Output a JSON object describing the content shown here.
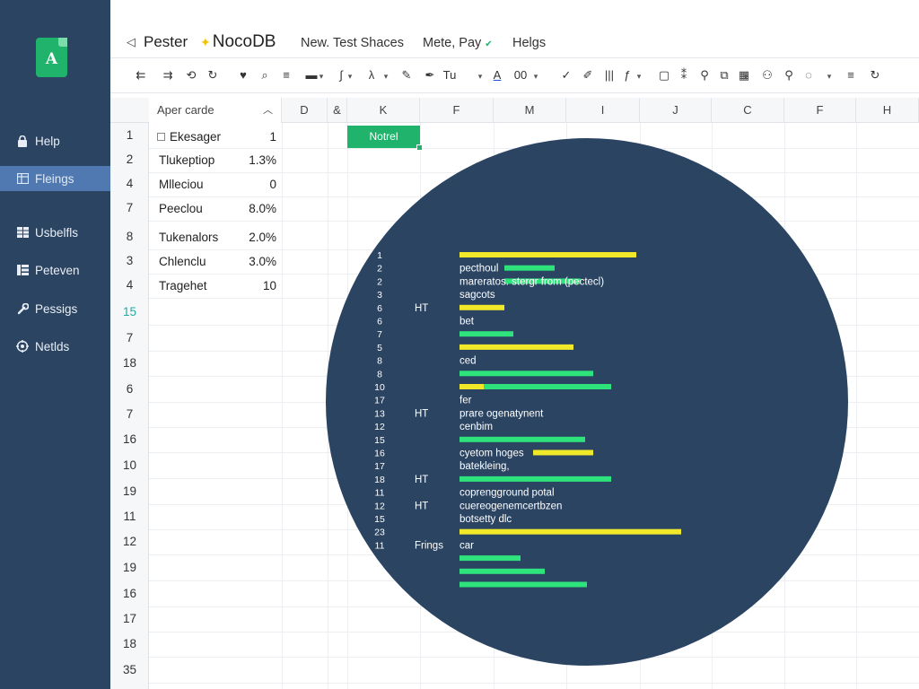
{
  "app": {
    "logo_letter": "A",
    "project": "Pester",
    "brand": "NocoDB",
    "back_icon": "back-arrow-icon"
  },
  "colors": {
    "sidebar_bg": "#2b4462",
    "accent_green": "#1fb36b",
    "bar_green": "#2ee27c",
    "bar_yellow": "#f2e82a",
    "active_item": "#4f79b0"
  },
  "top_menu": [
    {
      "label": "New. Test Shaces"
    },
    {
      "label": "Mete, Pay"
    },
    {
      "label": "Helgs"
    }
  ],
  "sidebar": {
    "items": [
      {
        "label": "Help",
        "icon": "lock-icon"
      },
      {
        "label": "Fleings",
        "icon": "table-icon"
      },
      {
        "label": "Usbelfls",
        "icon": "grid-icon"
      },
      {
        "label": "Peteven",
        "icon": "columns-icon"
      },
      {
        "label": "Pessigs",
        "icon": "wrench-icon"
      },
      {
        "label": "Netlds",
        "icon": "settings-icon"
      }
    ]
  },
  "toolbar": {
    "items": [
      {
        "glyph": "⇇",
        "icon": "undo-icon"
      },
      {
        "glyph": "⇉",
        "icon": "redo-icon"
      },
      {
        "glyph": "⟲",
        "icon": "history-icon"
      },
      {
        "glyph": "↻",
        "icon": "refresh-icon"
      },
      {
        "glyph": "♥",
        "icon": "heart-icon"
      },
      {
        "glyph": "⌕",
        "icon": "search-icon"
      },
      {
        "glyph": "≡",
        "icon": "list-icon"
      },
      {
        "glyph": "▬",
        "icon": "field-icon"
      },
      {
        "glyph": "∫",
        "icon": "formula-icon"
      },
      {
        "glyph": "λ",
        "icon": "lambda-icon"
      },
      {
        "glyph": "✎",
        "icon": "pencil-icon"
      },
      {
        "glyph": "✒",
        "icon": "pen-icon"
      },
      {
        "glyph": "Tu",
        "icon": "text-format-icon"
      },
      {
        "glyph": "A",
        "icon": "font-color-icon"
      },
      {
        "glyph": "00",
        "icon": "number-format-icon"
      },
      {
        "glyph": "✓",
        "icon": "check-icon"
      },
      {
        "glyph": "✐",
        "icon": "edit-icon"
      },
      {
        "glyph": "|||",
        "icon": "columns-icon"
      },
      {
        "glyph": "ƒ",
        "icon": "function-icon"
      },
      {
        "glyph": "▢",
        "icon": "frame-icon"
      },
      {
        "glyph": "⁑",
        "icon": "link-icon"
      },
      {
        "glyph": "⚲",
        "icon": "tag-icon"
      },
      {
        "glyph": "⧉",
        "icon": "copy-icon"
      },
      {
        "glyph": "▦",
        "icon": "calendar-icon"
      },
      {
        "glyph": "⚇",
        "icon": "user-icon"
      },
      {
        "glyph": "⚲",
        "icon": "pin-icon"
      },
      {
        "glyph": "◌",
        "icon": "loading-icon"
      },
      {
        "glyph": "≡",
        "icon": "menu-icon"
      },
      {
        "glyph": "↻",
        "icon": "reload-icon"
      }
    ]
  },
  "grid": {
    "first_col_header": "Aper carde",
    "column_headers": [
      "D",
      "&",
      "K",
      "F",
      "M",
      "I",
      "J",
      "C",
      "F",
      "H"
    ],
    "row_numbers": [
      "1",
      "2",
      "4",
      "7",
      "8",
      "3",
      "4",
      "15",
      "7",
      "18",
      "6",
      "7",
      "16",
      "10",
      "19",
      "11",
      "12",
      "19",
      "16",
      "17",
      "18",
      "35"
    ],
    "rows": [
      {
        "name": "Ekesager",
        "value": "1"
      },
      {
        "name": "Tlukeptiop",
        "value": "1.3%"
      },
      {
        "name": "Mlleciou",
        "value": "0"
      },
      {
        "name": "Peeclou",
        "value": "8.0%"
      },
      {
        "name": "Tukenalors",
        "value": "2.0%"
      },
      {
        "name": "Chlenclu",
        "value": "3.0%"
      },
      {
        "name": "Tragehet",
        "value": "10"
      }
    ],
    "selected_cell": "Notrel"
  },
  "chart_data": {
    "type": "bar",
    "orientation": "horizontal",
    "rows": [
      {
        "num": "1",
        "side": "",
        "label": "",
        "green": 0,
        "yellow": 197
      },
      {
        "num": "2",
        "side": "",
        "label": "pecthoul",
        "green": 56,
        "yellow": 0
      },
      {
        "num": "2",
        "side": "",
        "label": "mareratos. stergr from (pectecl)",
        "green": 85,
        "yellow": 0
      },
      {
        "num": "3",
        "side": "",
        "label": "sagcots",
        "green": 0,
        "yellow": 0
      },
      {
        "num": "6",
        "side": "HT",
        "label": "",
        "green": 0,
        "yellow": 50
      },
      {
        "num": "6",
        "side": "",
        "label": "bet",
        "green": 0,
        "yellow": 0
      },
      {
        "num": "7",
        "side": "",
        "label": "",
        "green": 60,
        "yellow": 0
      },
      {
        "num": "5",
        "side": "",
        "label": "",
        "green": 0,
        "yellow": 127
      },
      {
        "num": "8",
        "side": "",
        "label": "ced",
        "green": 0,
        "yellow": 0
      },
      {
        "num": "8",
        "side": "",
        "label": "",
        "green": 149,
        "yellow": 0
      },
      {
        "num": "10",
        "side": "",
        "label": "",
        "green": 142,
        "yellow": 27
      },
      {
        "num": "17",
        "side": "",
        "label": "fer",
        "green": 0,
        "yellow": 0
      },
      {
        "num": "13",
        "side": "HT",
        "label": "prare ogenatynent",
        "green": 0,
        "yellow": 0
      },
      {
        "num": "12",
        "side": "",
        "label": "cenbim",
        "green": 0,
        "yellow": 0
      },
      {
        "num": "15",
        "side": "",
        "label": "",
        "green": 140,
        "yellow": 0
      },
      {
        "num": "16",
        "side": "",
        "label": "cyetom hoges",
        "green": 0,
        "yellow": 67
      },
      {
        "num": "17",
        "side": "",
        "label": "batekleing,",
        "green": 0,
        "yellow": 0
      },
      {
        "num": "18",
        "side": "HT",
        "label": "",
        "green": 169,
        "yellow": 0
      },
      {
        "num": "11",
        "side": "",
        "label": "coprengground potal",
        "green": 0,
        "yellow": 0
      },
      {
        "num": "12",
        "side": "HT",
        "label": "cuereogenemcertbzen",
        "green": 0,
        "yellow": 0
      },
      {
        "num": "15",
        "side": "",
        "label": "botsetty dlc",
        "green": 0,
        "yellow": 0
      },
      {
        "num": "23",
        "side": "",
        "label": "",
        "green": 0,
        "yellow": 247
      },
      {
        "num": "11",
        "side": "Frings",
        "label": "car",
        "green": 0,
        "yellow": 0
      },
      {
        "num": "",
        "side": "",
        "label": "",
        "green": 68,
        "yellow": 0
      },
      {
        "num": "",
        "side": "",
        "label": "",
        "green": 95,
        "yellow": 0
      },
      {
        "num": "",
        "side": "",
        "label": "",
        "green": 142,
        "yellow": 0
      }
    ]
  }
}
